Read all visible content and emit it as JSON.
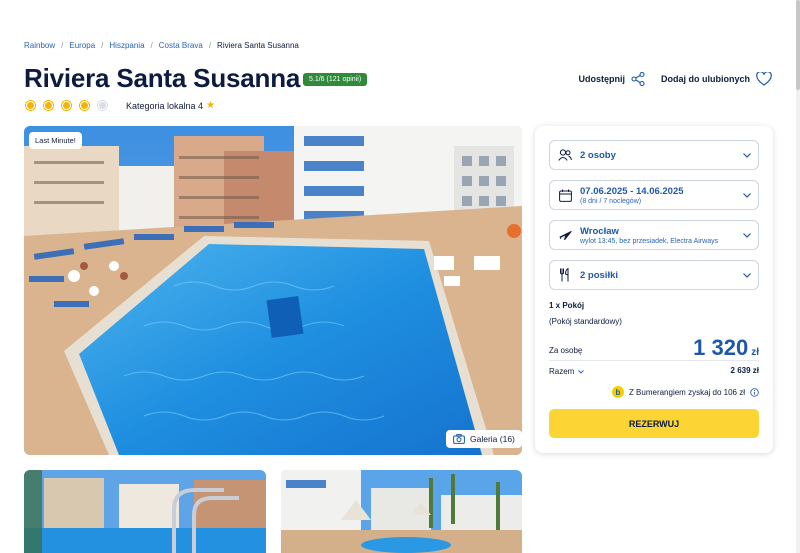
{
  "breadcrumb": [
    "Rainbow",
    "Europa",
    "Hiszpania",
    "Costa Brava",
    "Riviera Santa Susanna"
  ],
  "hotel": {
    "name": "Riviera Santa Susanna",
    "rating": "5.1/6 (121 opinii)",
    "stars": 4,
    "stars_max": 5,
    "category": "Kategoria lokalna 4"
  },
  "actions": {
    "share": "Udostępnij",
    "favorite": "Dodaj do ulubionych"
  },
  "photo": {
    "badge": "Last Minute!",
    "gallery": "Galeria (16)"
  },
  "booking": {
    "guests": "2 osoby",
    "dates": "07.06.2025 - 14.06.2025",
    "dates_sub": "(8 dni / 7 noclegów)",
    "departure": "Wrocław",
    "departure_sub": "wylot 13:45, bez przesiadek, Electra Airways",
    "meals": "2 posiłki",
    "room": "1 x Pokój",
    "room_type": "(Pokój standardowy)",
    "per_person_label": "Za osobę",
    "per_person": "1 320",
    "currency": "zł",
    "total_label": "Razem",
    "total": "2 639 zł",
    "bumerang": "Z Bumerangiem zyskaj do 106 zł",
    "reserve": "REZERWUJ"
  },
  "colors": {
    "accent": "#1d58a8",
    "cta": "#fcd535",
    "rating": "#2f8a3b",
    "star": "#f5b400"
  }
}
